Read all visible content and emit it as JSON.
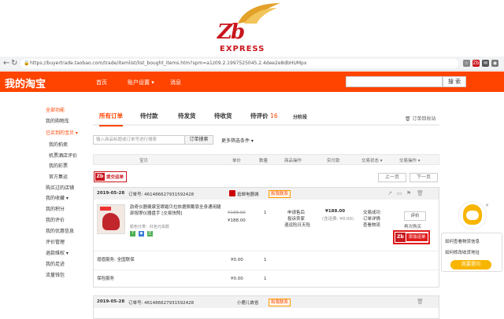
{
  "logo": {
    "brand": "Zb",
    "sub": "EXPRESS"
  },
  "browser": {
    "url": "https://buyertrade.taobao.com/trade/itemlist/list_bought_items.htm?spm=a1z09.2.1997525045.2.4dee2e8dbHUMpx",
    "ext_labels": [
      "☆",
      "Zb",
      "✉",
      "◉"
    ]
  },
  "topnav": {
    "title": "我的淘宝",
    "items": [
      "首页",
      "账户设置 ▾",
      "消息"
    ],
    "search_button": "搜 索"
  },
  "sidebar": {
    "items": [
      {
        "label": "全部功能",
        "red": true
      },
      {
        "label": "我的购物车",
        "red": false
      },
      {
        "label": "已买到的宝贝 ▾",
        "red": true
      },
      {
        "label": "我的拍卖",
        "red": false
      },
      {
        "label": "机票酒店评价",
        "red": false
      },
      {
        "label": "我的彩票",
        "red": false
      },
      {
        "label": "官方集运",
        "red": false
      },
      {
        "label": "购买过的店铺",
        "red": false
      },
      {
        "label": "我的收藏 ▾",
        "red": false
      },
      {
        "label": "我的积分",
        "red": false
      },
      {
        "label": "我的评价",
        "red": false
      },
      {
        "label": "我的优惠信息",
        "red": false
      },
      {
        "label": "评价管理",
        "red": false
      },
      {
        "label": "退款维权 ▾",
        "red": false
      },
      {
        "label": "我的足迹",
        "red": false
      },
      {
        "label": "流量钱包",
        "red": false
      }
    ]
  },
  "tabs": [
    {
      "label": "所有订单",
      "count": ""
    },
    {
      "label": "待付款",
      "count": ""
    },
    {
      "label": "待发货",
      "count": ""
    },
    {
      "label": "待收货",
      "count": ""
    },
    {
      "label": "待评价",
      "count": "16"
    },
    {
      "label": "分阶段",
      "count": ""
    }
  ],
  "recycle": "🗑 订单回收站",
  "filter": {
    "placeholder": "输入商品标题或订单号进行搜索",
    "button": "订单搜索",
    "more": "更多筛选条件 ▾"
  },
  "table_headers": [
    "宝贝",
    "单价",
    "数量",
    "商品操作",
    "实付款",
    "交易状态 ▾",
    "交易操作 ▾"
  ],
  "batch_badge": {
    "icon": "Zb",
    "label": "提交运单"
  },
  "pager": {
    "prev": "上一页",
    "next": "下一页"
  },
  "orders": [
    {
      "date": "2019-05-28",
      "order_no": "订单号: 461486627931592428",
      "shop": "逛邮电器城",
      "contact": "和我联系",
      "title": "韵奇仪器健康宝眼霜贝拉依据佩戴恩全身通用腿部按摩仪器盘手 [交易快照]",
      "spec": "颜色分类：红色元佑款",
      "tags": [
        {
          "t": "7",
          "c": "#4caf50"
        },
        {
          "t": "◆",
          "c": "#3a7bd5"
        },
        {
          "t": "正",
          "c": "#4caf50"
        }
      ],
      "orig_price": "¥188.00",
      "price": "¥188.00",
      "qty": "1",
      "ops": [
        "申请售后",
        "投诉卖家",
        "退运险日天险"
      ],
      "paid": "¥188.00",
      "paid_note": "(含运费: ¥0.00)",
      "status": [
        "交易成功",
        "订单详情",
        "查看物流"
      ],
      "eval": "评价",
      "more": "再次购买",
      "add_label": "添加运单",
      "add_icon": "Zb",
      "services": [
        {
          "label": "增值服务: 全国联保",
          "price": "¥0.00",
          "qty": "1"
        },
        {
          "label": "保险服务",
          "price": "¥0.00",
          "qty": "1"
        }
      ]
    },
    {
      "date": "2019-05-28",
      "order_no": "订单号: 461486627931592428",
      "shop": "小鹿儿故省",
      "contact": "和我联系"
    }
  ],
  "assistant": {
    "questions": [
      "如何查看物流信息",
      "如何修改收货地址"
    ],
    "ask": "我要提问",
    "close": "×"
  }
}
